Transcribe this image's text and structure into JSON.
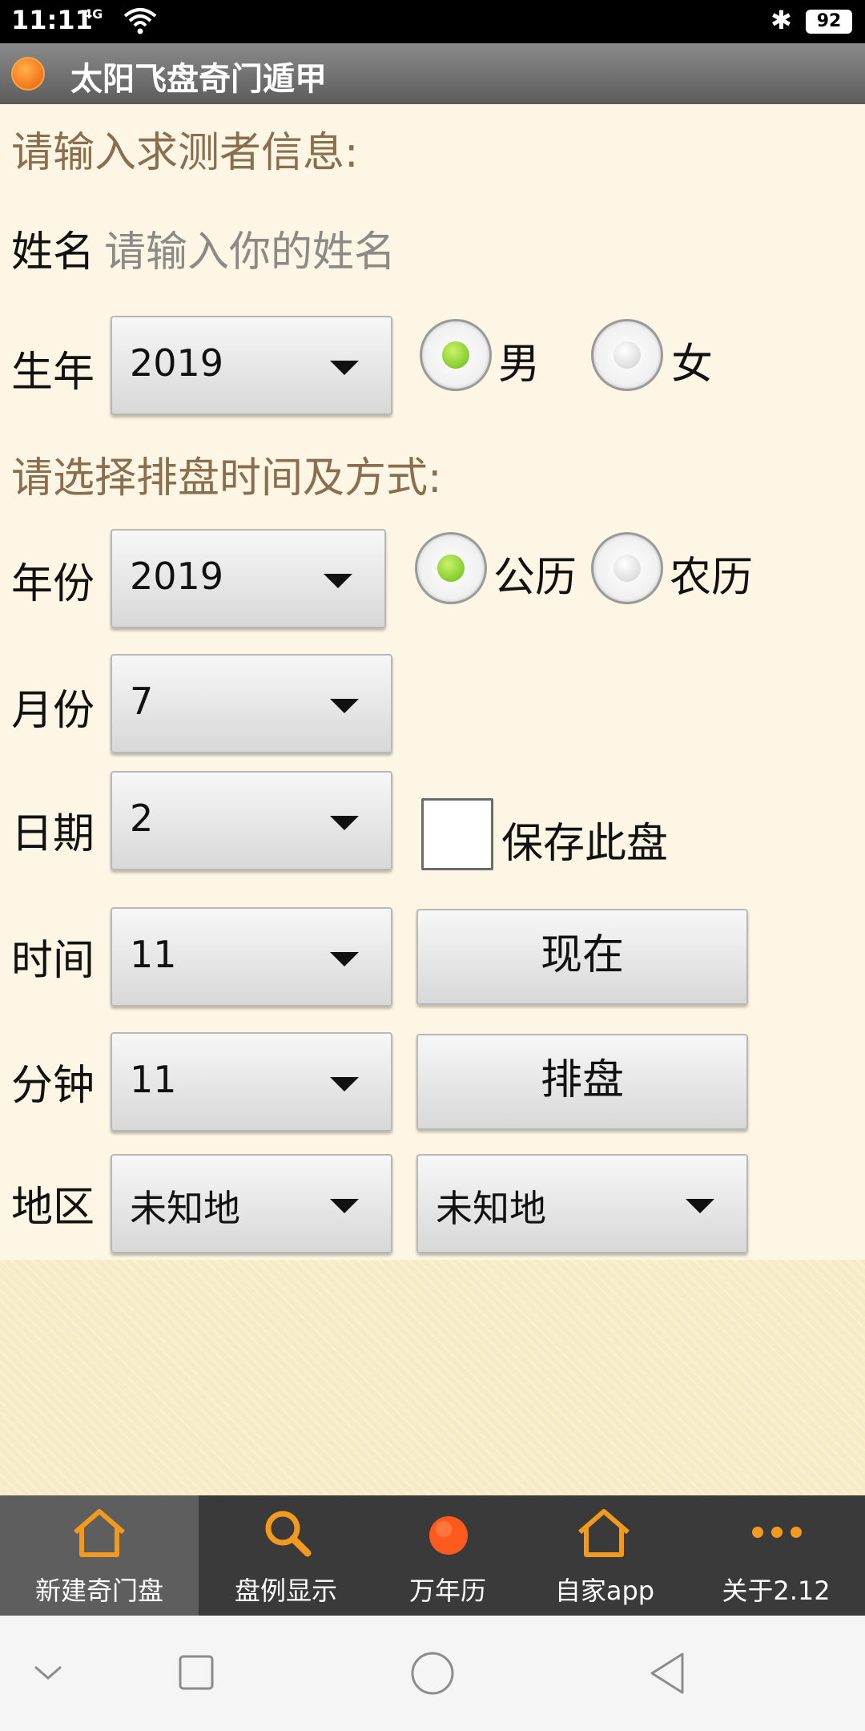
{
  "status_bar": {
    "time": "11:11",
    "network": "4G",
    "battery": "92"
  },
  "app": {
    "title": "太阳飞盘奇门遁甲"
  },
  "form": {
    "section1": "请输入求测者信息:",
    "name_label": "姓名",
    "name_placeholder": "请输入你的姓名",
    "birth_year_label": "生年",
    "birth_year_value": "2019",
    "gender_male": "男",
    "gender_female": "女",
    "gender_selected": "男",
    "section2": "请选择排盘时间及方式:",
    "year_label": "年份",
    "year_value": "2019",
    "calendar_solar": "公历",
    "calendar_lunar": "农历",
    "calendar_selected": "公历",
    "month_label": "月份",
    "month_value": "7",
    "day_label": "日期",
    "day_value": "2",
    "save_label": "保存此盘",
    "save_checked": false,
    "hour_label": "时间",
    "hour_value": "11",
    "now_button": "现在",
    "minute_label": "分钟",
    "minute_value": "11",
    "arrange_button": "排盘",
    "region_label": "地区",
    "region_value_1": "未知地",
    "region_value_2": "未知地"
  },
  "tabs": [
    {
      "label": "新建奇门盘",
      "icon": "home-icon",
      "active": true
    },
    {
      "label": "盘例显示",
      "icon": "search-icon",
      "active": false
    },
    {
      "label": "万年历",
      "icon": "orange-dot-icon",
      "active": false
    },
    {
      "label": "自家app",
      "icon": "home-icon",
      "active": false
    },
    {
      "label": "关于2.12",
      "icon": "more-icon",
      "active": false
    }
  ],
  "colors": {
    "accent_orange": "#f39a1e",
    "section_label": "#8b6e4e",
    "radio_selected": "#7cc424",
    "background": "#fbf3dc"
  }
}
